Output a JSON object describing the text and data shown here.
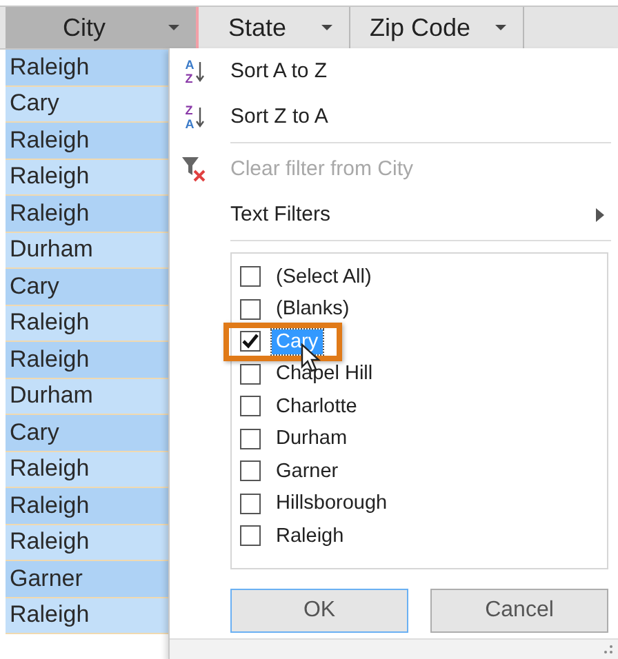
{
  "columns": [
    {
      "label": "City",
      "selected": true
    },
    {
      "label": "State",
      "selected": false
    },
    {
      "label": "Zip Code",
      "selected": false
    }
  ],
  "city_cells": [
    "Raleigh",
    "Cary",
    "Raleigh",
    "Raleigh",
    "Raleigh",
    "Durham",
    "Cary",
    "Raleigh",
    "Raleigh",
    "Durham",
    "Cary",
    "Raleigh",
    "Raleigh",
    "Raleigh",
    "Garner",
    "Raleigh"
  ],
  "menu": {
    "items": [
      {
        "kind": "sort-asc",
        "label": "Sort A to Z",
        "icon_top": "A",
        "icon_bottom": "Z",
        "disabled": false
      },
      {
        "kind": "sort-desc",
        "label": "Sort Z to A",
        "icon_top": "Z",
        "icon_bottom": "A",
        "disabled": false
      },
      {
        "kind": "clear-filter",
        "label": "Clear filter from City",
        "disabled": true
      },
      {
        "kind": "submenu",
        "label": "Text Filters",
        "disabled": false
      }
    ],
    "values": [
      {
        "label": "(Select All)",
        "checked": false,
        "selected": false
      },
      {
        "label": "(Blanks)",
        "checked": false,
        "selected": false
      },
      {
        "label": "Cary",
        "checked": true,
        "selected": true
      },
      {
        "label": "Chapel Hill",
        "checked": false,
        "selected": false
      },
      {
        "label": "Charlotte",
        "checked": false,
        "selected": false
      },
      {
        "label": "Durham",
        "checked": false,
        "selected": false
      },
      {
        "label": "Garner",
        "checked": false,
        "selected": false
      },
      {
        "label": "Hillsborough",
        "checked": false,
        "selected": false
      },
      {
        "label": "Raleigh",
        "checked": false,
        "selected": false
      }
    ],
    "buttons": [
      "OK",
      "Cancel"
    ]
  }
}
